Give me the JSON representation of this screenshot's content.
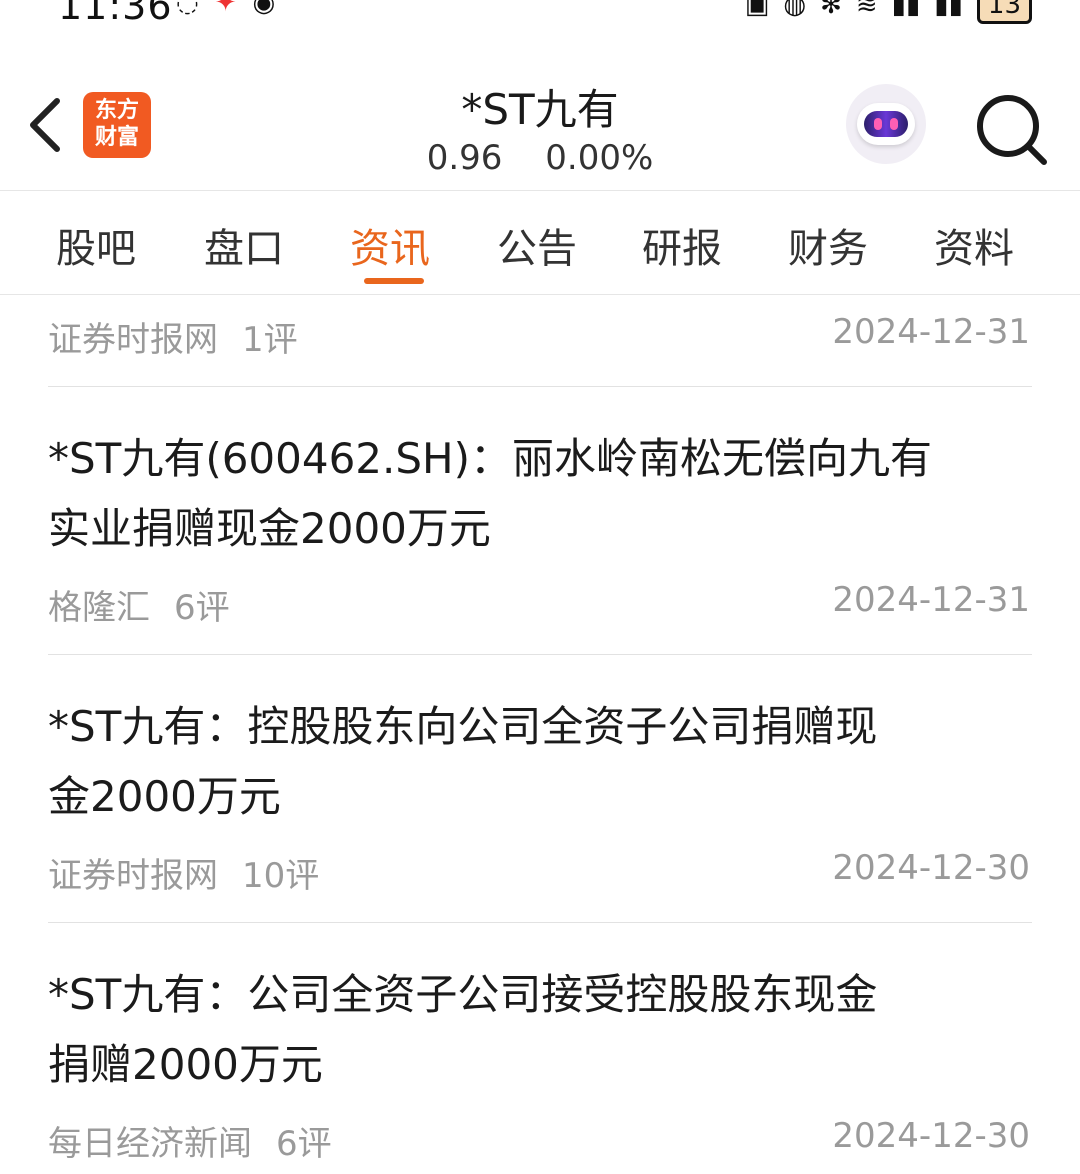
{
  "status_bar": {
    "time": "11:36",
    "battery": "13"
  },
  "header": {
    "logo_line1": "东方",
    "logo_line2": "财富",
    "stock_name": "*ST九有",
    "price": "0.96",
    "change_pct": "0.00%"
  },
  "tabs": [
    {
      "label": "股吧"
    },
    {
      "label": "盘口"
    },
    {
      "label": "资讯",
      "active": true
    },
    {
      "label": "公告"
    },
    {
      "label": "研报"
    },
    {
      "label": "财务"
    },
    {
      "label": "资料"
    }
  ],
  "news": [
    {
      "title": "",
      "source": "证券时报网",
      "comments": "1评",
      "date": "2024-12-31"
    },
    {
      "title_line1": "*ST九有(600462.SH)：丽水岭南松无偿向九有",
      "title_line2": "实业捐赠现金2000万元",
      "source": "格隆汇",
      "comments": "6评",
      "date": "2024-12-31"
    },
    {
      "title_line1": "*ST九有：控股股东向公司全资子公司捐赠现",
      "title_line2": "金2000万元",
      "source": "证券时报网",
      "comments": "10评",
      "date": "2024-12-30"
    },
    {
      "title_line1": "*ST九有：公司全资子公司接受控股股东现金",
      "title_line2": "捐赠2000万元",
      "source": "每日经济新闻",
      "comments": "6评",
      "date": "2024-12-30"
    }
  ],
  "colors": {
    "accent": "#e9661d",
    "logo": "#f15a22",
    "meta_text": "#9a9a9a"
  }
}
